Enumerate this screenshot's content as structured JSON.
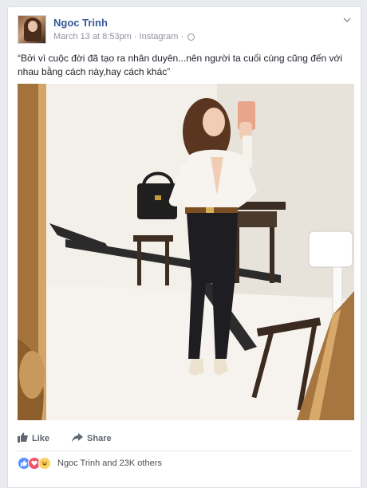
{
  "post": {
    "author": "Ngoc Trinh",
    "date": "March 13 at 8:53pm",
    "separator": "·",
    "source": "Instagram",
    "caption": "“Bởi vì cuộc đời đã tạo ra nhân duyên...nên người ta cuối cùng cũng đến với nhau bằng cách này,hay cách khác”"
  },
  "actions": {
    "like": "Like",
    "share": "Share"
  },
  "reactions": {
    "summary": "Ngoc Trinh and 23K others",
    "types": [
      "like-icon",
      "love-icon",
      "haha-icon"
    ]
  },
  "colors": {
    "name": "#365899",
    "meta": "#90949c",
    "like_blue": "#5890ff",
    "love_red": "#f25268",
    "haha_yellow": "#fcd264"
  }
}
